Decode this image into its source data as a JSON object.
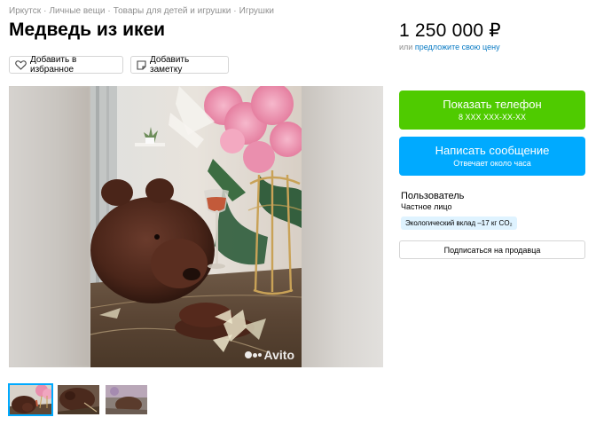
{
  "breadcrumbs": [
    "Иркутск",
    "Личные вещи",
    "Товары для детей и игрушки",
    "Игрушки"
  ],
  "breadcrumb_separator": "·",
  "listing": {
    "title": "Медведь из икеи",
    "price": "1 250 000 ₽",
    "price_prefix": "или",
    "price_offer_link": "предложите свою цену"
  },
  "actions": {
    "favorite_label": "Добавить в избранное",
    "note_label": "Добавить заметку"
  },
  "contact": {
    "phone_label": "Показать телефон",
    "phone_masked": "8 XXX XXX-XX-XX",
    "message_label": "Написать сообщение",
    "message_sub": "Отвечает около часа"
  },
  "seller": {
    "name": "Пользователь",
    "type": "Частное лицо",
    "eco_badge": "Экологический вклад –17 кг CO₂",
    "subscribe_label": "Подписаться на продавца"
  },
  "gallery": {
    "watermark": "Avito",
    "thumbnail_count": 3,
    "active_thumbnail": 1
  },
  "colors": {
    "phone_button": "#4fcb00",
    "message_button": "#00aaff",
    "link": "#0a7bc4",
    "eco_badge_bg": "#dff3ff",
    "muted_text": "#8f8f8f"
  }
}
